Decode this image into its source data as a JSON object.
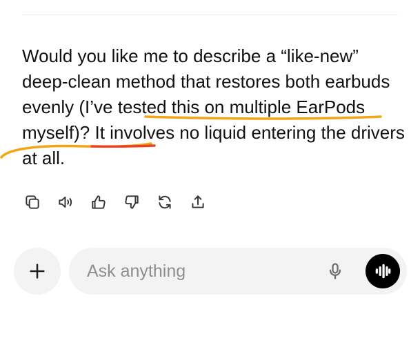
{
  "conversation": {
    "message": {
      "text_before": "Would you like me to describe a “like-new” deep-clean method that restores both earbuds evenly ",
      "highlighted_text": "(I’ve tested this on multiple EarPods myself)",
      "text_after": "? It involves no liquid entering the drivers at all."
    },
    "annotation_colors": {
      "primary_underline": "#f2a516",
      "secondary_underline": "#e8431f"
    }
  },
  "message_actions": {
    "items": [
      {
        "icon": "copy-icon"
      },
      {
        "icon": "read-aloud-icon"
      },
      {
        "icon": "thumbs-up-icon"
      },
      {
        "icon": "thumbs-down-icon"
      },
      {
        "icon": "regenerate-icon"
      },
      {
        "icon": "share-icon"
      }
    ]
  },
  "composer": {
    "placeholder": "Ask anything",
    "value": "",
    "attach_icon": "plus-icon",
    "mic_icon": "microphone-icon",
    "voice_icon": "voice-mode-icon"
  },
  "colors": {
    "background": "#ffffff",
    "text": "#111111",
    "composer_bg": "#f3f3f3",
    "voice_button_bg": "#000000"
  }
}
